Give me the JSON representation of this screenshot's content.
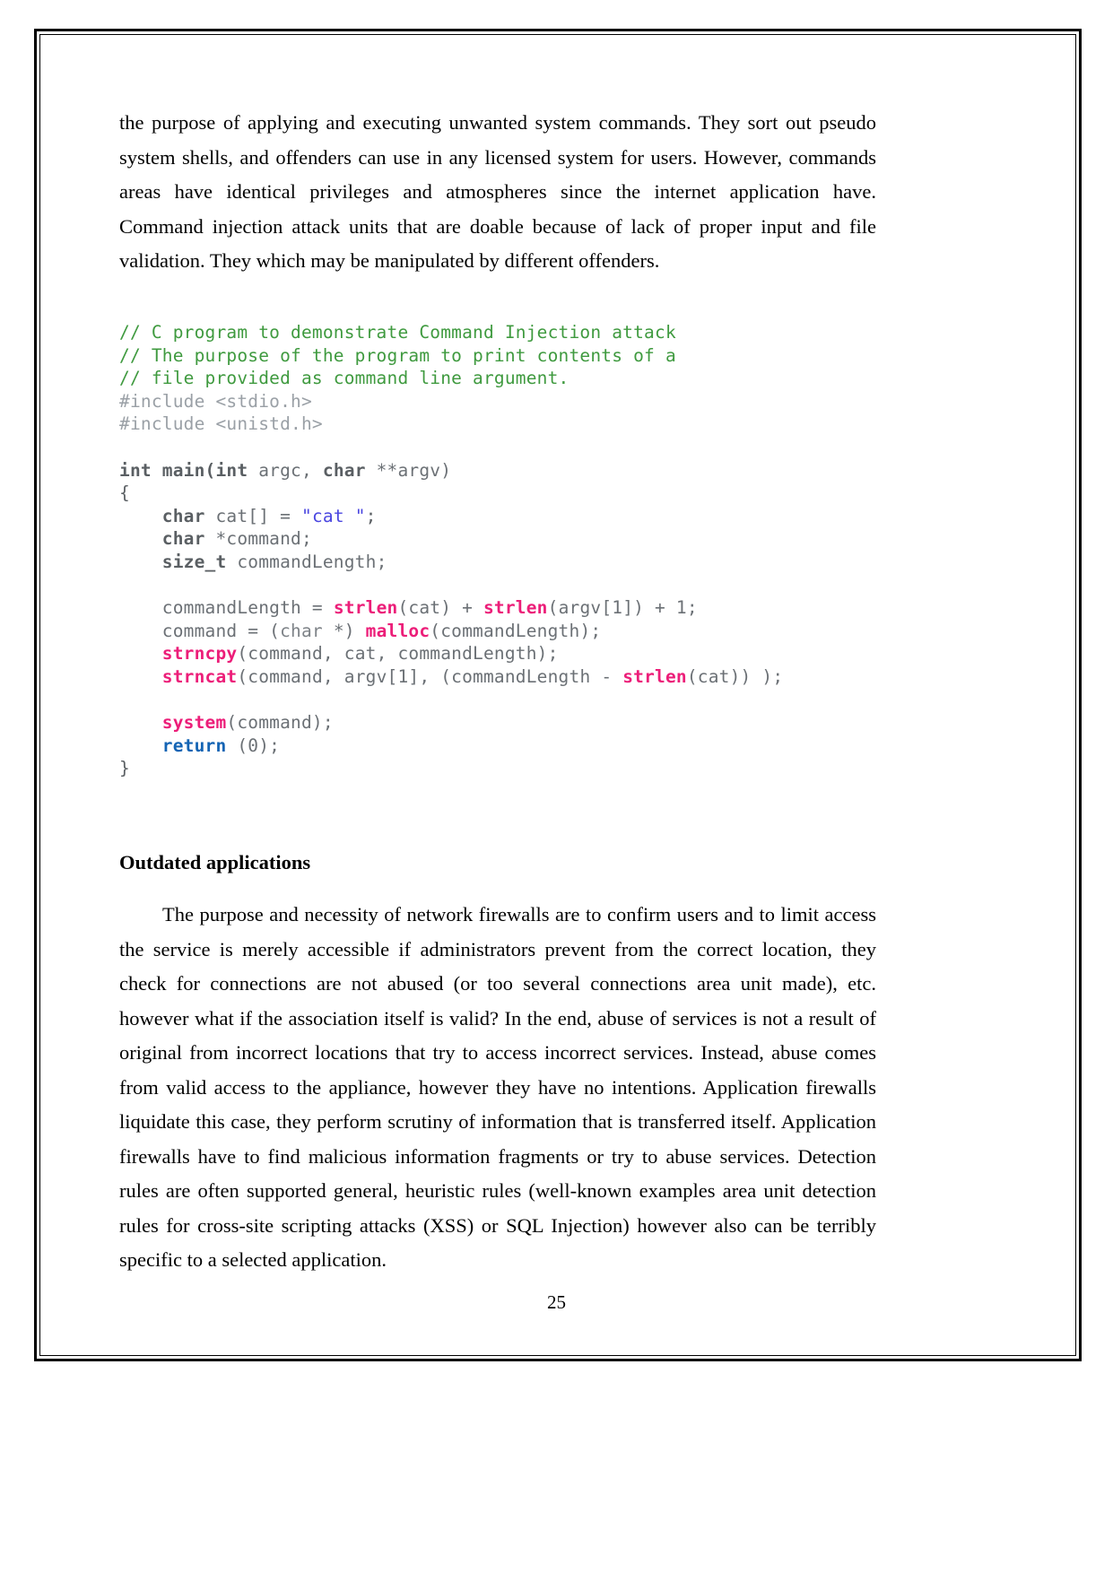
{
  "document": {
    "page_number": "25",
    "paragraph_1": "the purpose of applying and executing unwanted system commands. They sort out pseudo system shells, and offenders can use in any licensed system for users. However, commands areas have identical privileges and atmospheres since the internet application have. Command injection attack units that are doable because of lack of proper input and file validation. They which may be manipulated by different offenders.",
    "heading_outdated": "Outdated applications",
    "paragraph_2": "The purpose and necessity of network firewalls are to confirm users and to limit access the service is merely accessible if administrators prevent from the correct location, they check for connections are not abused (or too several connections area unit made), etc. however what if the association itself is valid? In the end, abuse of services is not a result of original from incorrect locations that try to access incorrect services. Instead, abuse comes from valid access to the appliance, however they have no intentions.  Application firewalls liquidate this case, they perform scrutiny of information that is transferred itself. Application firewalls have to find malicious information fragments or try to abuse services. Detection rules are often supported general, heuristic rules (well-known examples area unit detection rules for cross-site scripting attacks (XSS) or SQL Injection) however also can be terribly specific to a selected application."
  },
  "code": {
    "language": "c",
    "colors": {
      "comment": "#3f9a3f",
      "preprocessor": "#9aa0a6",
      "keyword": "#5a5f63",
      "string": "#4a46e0",
      "function": "#ec1e79",
      "return_keyword": "#1464b4"
    },
    "lines": [
      {
        "id": 1,
        "text": "// C program to demonstrate Command Injection attack"
      },
      {
        "id": 2,
        "text": "// The purpose of the program to print contents of a"
      },
      {
        "id": 3,
        "text": "// file provided as command line argument."
      },
      {
        "id": 4,
        "text": "#include <stdio.h>"
      },
      {
        "id": 5,
        "text": "#include <unistd.h>"
      },
      {
        "id": 6,
        "text": ""
      },
      {
        "id": 7,
        "text": "int main(int argc, char **argv)"
      },
      {
        "id": 8,
        "text": "{"
      },
      {
        "id": 9,
        "text": "    char cat[] = \"cat \";"
      },
      {
        "id": 10,
        "text": "    char *command;"
      },
      {
        "id": 11,
        "text": "    size_t commandLength;"
      },
      {
        "id": 12,
        "text": ""
      },
      {
        "id": 13,
        "text": "    commandLength = strlen(cat) + strlen(argv[1]) + 1;"
      },
      {
        "id": 14,
        "text": "    command = (char *) malloc(commandLength);"
      },
      {
        "id": 15,
        "text": "    strncpy(command, cat, commandLength);"
      },
      {
        "id": 16,
        "text": "    strncat(command, argv[1], (commandLength - strlen(cat)) );"
      },
      {
        "id": 17,
        "text": ""
      },
      {
        "id": 18,
        "text": "    system(command);"
      },
      {
        "id": 19,
        "text": "    return (0);"
      },
      {
        "id": 20,
        "text": "}"
      }
    ],
    "tokens": {
      "l1": "// C program to demonstrate Command Injection attack",
      "l2": "// The purpose of the program to print contents of a",
      "l3": "// file provided as command line argument.",
      "l4": "#include <stdio.h>",
      "l5": "#include <unistd.h>",
      "l7_kw_int": "int",
      "l7_name": " main(",
      "l7_kw_int2": "int",
      "l7_arg": " argc, ",
      "l7_kw_char": "char",
      "l7_rest": " **argv)",
      "l8": "{",
      "l9_kw": "char",
      "l9_mid": " cat[] = ",
      "l9_str": "\"cat \"",
      "l9_end": ";",
      "l10_kw": "char",
      "l10_rest": " *command;",
      "l11_kw": "size_t",
      "l11_rest": " commandLength;",
      "l13_a": "commandLength = ",
      "l13_f1": "strlen",
      "l13_b": "(cat) + ",
      "l13_f2": "strlen",
      "l13_c": "(argv[1]) + 1;",
      "l14_a": "command = (",
      "l14_kw": "char",
      "l14_b": " *) ",
      "l14_f": "malloc",
      "l14_c": "(commandLength);",
      "l15_f": "strncpy",
      "l15_rest": "(command, cat, commandLength);",
      "l16_f": "strncat",
      "l16_a": "(command, argv[1], (commandLength - ",
      "l16_f2": "strlen",
      "l16_b": "(cat)) );",
      "l18_f": "system",
      "l18_rest": "(command);",
      "l19_kw": "return",
      "l19_rest": " (0);",
      "l20": "}"
    }
  }
}
